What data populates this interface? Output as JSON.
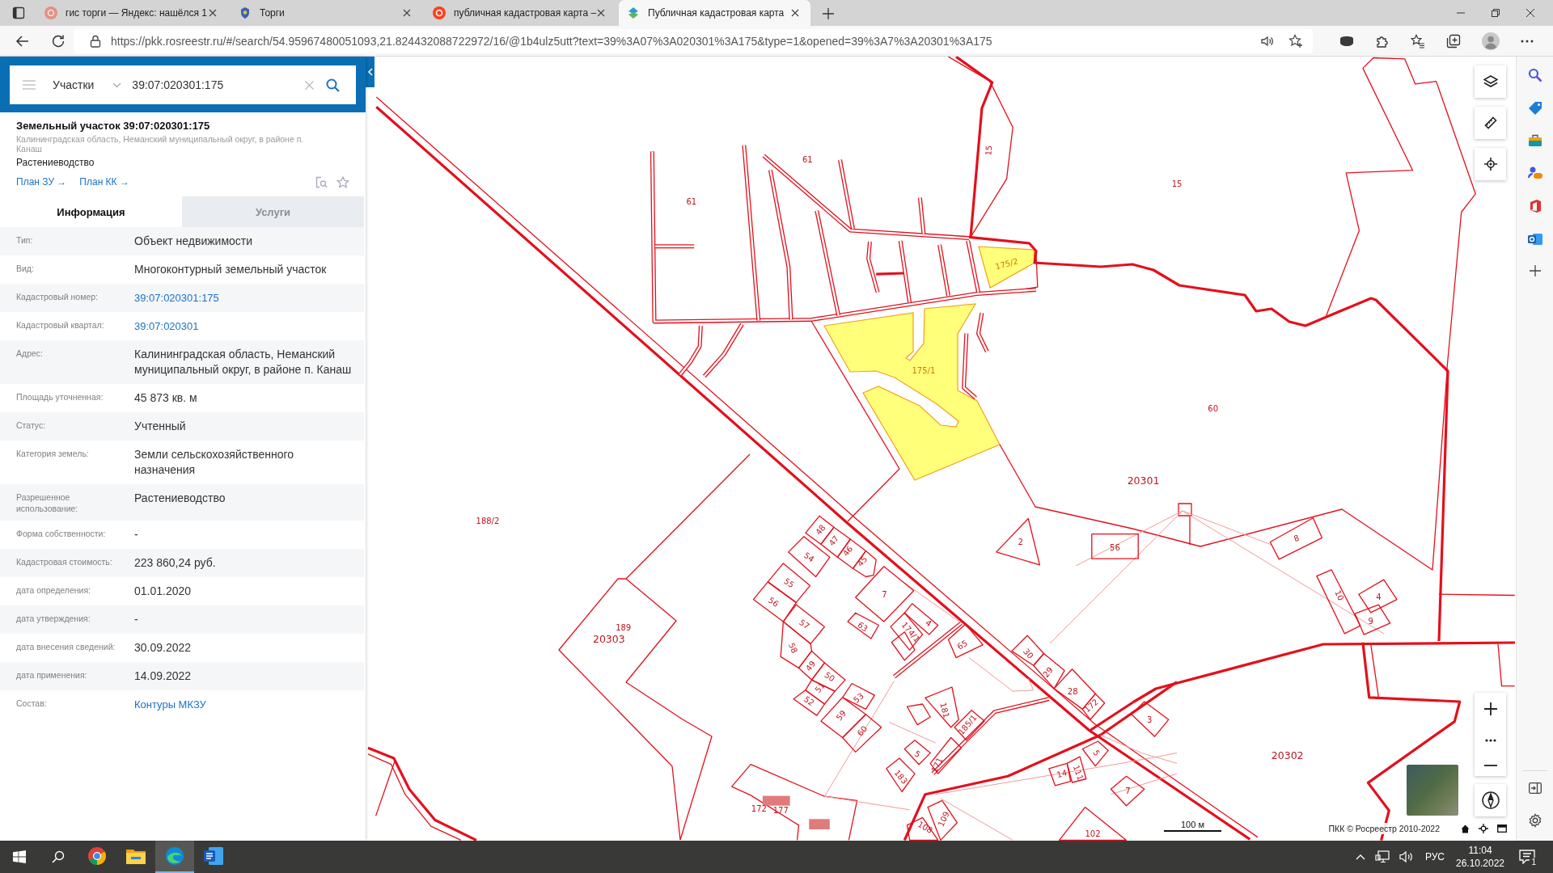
{
  "browser": {
    "tabs": [
      {
        "title": "гис торги — Яндекс: нашёлся 1",
        "kind": "search",
        "sleeping": true,
        "selected": false
      },
      {
        "title": "Торги",
        "kind": "emblem",
        "sleeping": false,
        "selected": false
      },
      {
        "title": "публичная кадастровая карта –",
        "kind": "search",
        "sleeping": false,
        "selected": false
      },
      {
        "title": "Публичная кадастровая карта",
        "kind": "map",
        "sleeping": false,
        "selected": true
      }
    ],
    "url": "https://pkk.rosreestr.ru/#/search/54.95967480051093,21.824432088722972/16/@1b4ulz5utt?text=39%3A07%3A020301%3A175&type=1&opened=39%3A7%3A20301%3A175"
  },
  "search": {
    "category": "Участки",
    "query": "39:07:020301:175"
  },
  "object": {
    "title": "Земельный участок 39:07:020301:175",
    "address": "Калининградская область, Неманский муниципальный округ, в районе п. Канаш",
    "purpose": "Растениеводство",
    "links": [
      "План ЗУ →",
      "План КК →"
    ]
  },
  "info_tabs": [
    {
      "label": "Информация",
      "selected": true
    },
    {
      "label": "Услуги",
      "selected": false
    }
  ],
  "fields": [
    {
      "label": "Тип:",
      "value": "Объект недвижимости",
      "kind": "text"
    },
    {
      "label": "Вид:",
      "value": "Многоконтурный земельный участок",
      "kind": "text"
    },
    {
      "label": "Кадастровый номер:",
      "value": "39:07:020301:175",
      "kind": "link"
    },
    {
      "label": "Кадастровый квартал:",
      "value": "39:07:020301",
      "kind": "link"
    },
    {
      "label": "Адрес:",
      "value": "Калининградская область, Неманский муниципальный округ, в районе п. Канаш",
      "kind": "text"
    },
    {
      "label": "Площадь уточненная:",
      "value": "45 873 кв. м",
      "kind": "text"
    },
    {
      "label": "Статус:",
      "value": "Учтенный",
      "kind": "text"
    },
    {
      "label": "Категория земель:",
      "value": "Земли сельскохозяйственного назначения",
      "kind": "text"
    },
    {
      "label": "Разрешенное использование:",
      "value": "Растениеводство",
      "kind": "text"
    },
    {
      "label": "Форма собственности:",
      "value": "-",
      "kind": "text"
    },
    {
      "label": "Кадастровая стоимость:",
      "value": "223 860,24 руб.",
      "kind": "text"
    },
    {
      "label": "дата определения:",
      "value": "01.01.2020",
      "kind": "text"
    },
    {
      "label": "дата утверждения:",
      "value": "-",
      "kind": "text"
    },
    {
      "label": "дата внесения сведений:",
      "value": "30.09.2022",
      "kind": "text"
    },
    {
      "label": "дата применения:",
      "value": "14.09.2022",
      "kind": "text"
    },
    {
      "label": "Состав:",
      "value": "Контуры МКЗУ",
      "kind": "link"
    }
  ],
  "map": {
    "labels": [
      {
        "text": "15",
        "kind": "parcel"
      },
      {
        "text": "61",
        "kind": "parcel"
      },
      {
        "text": "15",
        "kind": "parcel"
      },
      {
        "text": "61",
        "kind": "parcel"
      },
      {
        "text": "175/2",
        "kind": "contour"
      },
      {
        "text": "175/1",
        "kind": "contour"
      },
      {
        "text": "60",
        "kind": "parcel"
      },
      {
        "text": "20301",
        "kind": "quarter"
      },
      {
        "text": "188/2",
        "kind": "parcel"
      },
      {
        "text": "48",
        "kind": "parcel"
      },
      {
        "text": "47",
        "kind": "parcel"
      },
      {
        "text": "2",
        "kind": "parcel"
      },
      {
        "text": "56",
        "kind": "parcel"
      },
      {
        "text": "8",
        "kind": "parcel"
      },
      {
        "text": "46",
        "kind": "parcel"
      },
      {
        "text": "54",
        "kind": "parcel"
      },
      {
        "text": "45",
        "kind": "parcel"
      },
      {
        "text": "55",
        "kind": "parcel"
      },
      {
        "text": "7",
        "kind": "parcel"
      },
      {
        "text": "56",
        "kind": "parcel"
      },
      {
        "text": "57",
        "kind": "parcel"
      },
      {
        "text": "63",
        "kind": "parcel"
      },
      {
        "text": "174/1",
        "kind": "parcel"
      },
      {
        "text": "4",
        "kind": "parcel"
      },
      {
        "text": "10",
        "kind": "parcel"
      },
      {
        "text": "4",
        "kind": "parcel"
      },
      {
        "text": "9",
        "kind": "parcel"
      },
      {
        "text": "189",
        "kind": "parcel"
      },
      {
        "text": "20303",
        "kind": "quarter"
      },
      {
        "text": "65",
        "kind": "parcel"
      },
      {
        "text": "58",
        "kind": "parcel"
      },
      {
        "text": "30",
        "kind": "parcel"
      },
      {
        "text": "49",
        "kind": "parcel"
      },
      {
        "text": "29",
        "kind": "parcel"
      },
      {
        "text": "50",
        "kind": "parcel"
      },
      {
        "text": "51",
        "kind": "parcel"
      },
      {
        "text": "28",
        "kind": "parcel"
      },
      {
        "text": "53",
        "kind": "parcel"
      },
      {
        "text": "52",
        "kind": "parcel"
      },
      {
        "text": "172",
        "kind": "parcel"
      },
      {
        "text": "181",
        "kind": "parcel"
      },
      {
        "text": "59",
        "kind": "parcel"
      },
      {
        "text": "3",
        "kind": "parcel"
      },
      {
        "text": "185/1",
        "kind": "parcel"
      },
      {
        "text": "60",
        "kind": "parcel"
      },
      {
        "text": "5",
        "kind": "parcel"
      },
      {
        "text": "5",
        "kind": "parcel"
      },
      {
        "text": "171",
        "kind": "parcel"
      },
      {
        "text": "14",
        "kind": "parcel"
      },
      {
        "text": "111",
        "kind": "parcel"
      },
      {
        "text": "183",
        "kind": "parcel"
      },
      {
        "text": "7",
        "kind": "parcel"
      },
      {
        "text": "20302",
        "kind": "quarter"
      },
      {
        "text": "172",
        "kind": "parcel"
      },
      {
        "text": "177",
        "kind": "parcel"
      },
      {
        "text": "109",
        "kind": "parcel"
      },
      {
        "text": "108",
        "kind": "parcel"
      },
      {
        "text": "102",
        "kind": "parcel"
      }
    ],
    "scale": "100 м",
    "attribution": "ПКК © Росреестр 2010-2022"
  },
  "taskbar": {
    "apps": [
      {
        "kind": "ring",
        "selected": false
      },
      {
        "kind": "folder",
        "selected": false
      },
      {
        "kind": "wave",
        "selected": true
      },
      {
        "kind": "doc",
        "selected": false
      }
    ],
    "language": "РУС",
    "time": "11:04",
    "date": "26.10.2022",
    "notifications": "1"
  }
}
